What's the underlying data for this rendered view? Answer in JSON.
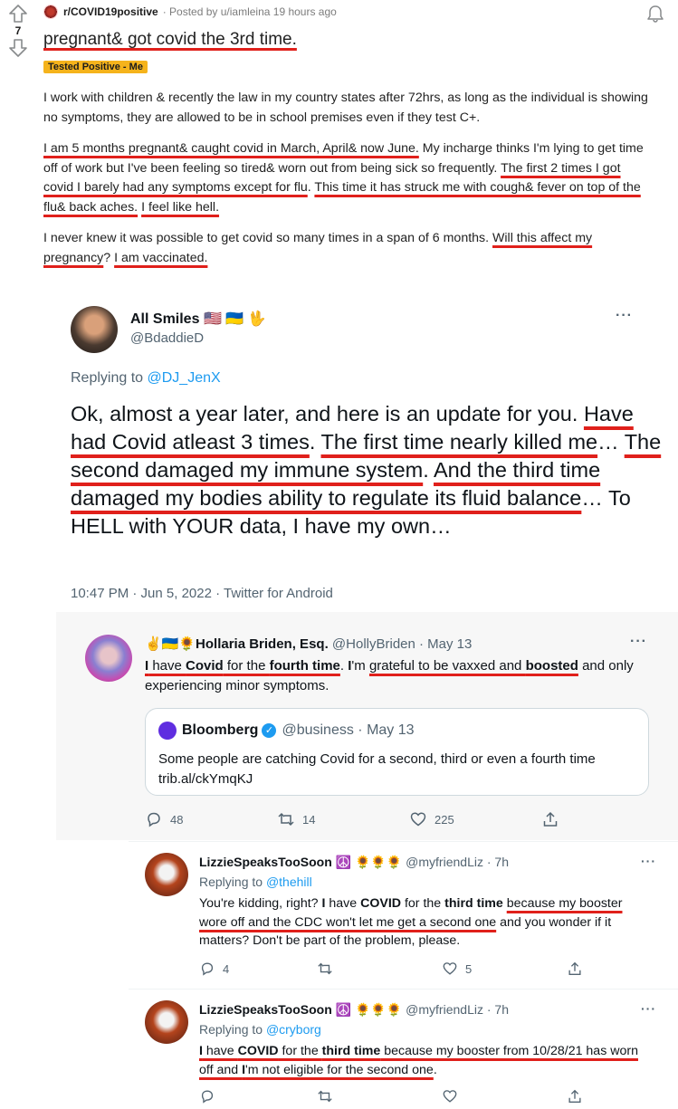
{
  "reddit": {
    "subreddit": "r/COVID19positive",
    "posted_by": "· Posted by u/iamleina 19 hours ago",
    "score": "7",
    "title": "pregnant& got covid the 3rd time.",
    "flair": "Tested Positive - Me",
    "p1": "I work with children & recently the law in my country states after 72hrs, as long as the individual is showing no symptoms, they are allowed to be in school premises even if they test C+.",
    "p2_a": "I am 5 months pregnant& caught covid in March, April& now June.",
    "p2_b": " My incharge thinks I'm lying to get time off of work but I've been feeling so tired& worn out from being sick so frequently. ",
    "p2_c": "The first 2 times I got covid I barely had any symptoms except for flu",
    "p2_d": ". ",
    "p2_e": "This time it has struck me with cough& fever on top of the flu& back aches.",
    "p2_f": " ",
    "p2_g": "I feel like hell.",
    "p3_a": "I never knew it was possible to get covid so many times in a span of 6 months. ",
    "p3_b": "Will this affect my pregnancy",
    "p3_c": "? ",
    "p3_d": "I am vaccinated."
  },
  "tweet1": {
    "name": "All Smiles",
    "name_emoji": "🇺🇸 🇺🇦 🖖",
    "handle": "@BdaddieD",
    "replying_label": "Replying to ",
    "replying_to": "@DJ_JenX",
    "t_a": "Ok, almost a year later, and here is an update for you. ",
    "t_b": "Have had Covid atleast 3 times",
    "t_c": ". ",
    "t_d": "The first time nearly killed me",
    "t_e": "… ",
    "t_f": "The second damaged my immune system",
    "t_g": ". ",
    "t_h": "And the third time damaged my bodies ability to regulate its fluid balance",
    "t_i": "… To HELL with YOUR data, I have my own…",
    "date": "10:47 PM · Jun 5, 2022 · Twitter for Android",
    "more": "···"
  },
  "tweet2": {
    "name_emoji": "✌️🇺🇦🌻",
    "name": "Hollaria Briden, Esq.",
    "handle_time": "@HollyBriden · May 13",
    "more": "···",
    "t_a": "I",
    "t_b": " have ",
    "t_c": "Covid",
    "t_d": " for the ",
    "t_e": "fourth time",
    "t_f": ".  ",
    "t_g": "I",
    "t_h": "'m ",
    "t_i": "grateful to be vaxxed and ",
    "t_j": "boosted",
    "t_k": " and only experiencing minor symptoms.",
    "quote": {
      "name": "Bloomberg",
      "handle_time": "@business · May 13",
      "text": "Some people are catching Covid for a second, third or even a fourth time trib.al/ckYmqKJ"
    },
    "replies": "48",
    "retweets": "14",
    "likes": "225"
  },
  "tweet3": {
    "name": "LizzieSpeaksTooSoon",
    "name_emoji": "☮️ 🌻🌻🌻",
    "handle_time": "@myfriendLiz · 7h",
    "more": "···",
    "replying_label": "Replying to ",
    "replying_to": "@thehill",
    "t_a": "You're kidding, right? ",
    "t_b": "I",
    "t_c": " have ",
    "t_d": "COVID",
    "t_e": " for the ",
    "t_f": "third time",
    "t_g": " ",
    "t_h": "because my booster wore off and the CDC won't let me get a second one",
    "t_i": " and you wonder if it matters? Don't be part of the problem, please.",
    "replies": "4",
    "retweets": "",
    "likes": "5"
  },
  "tweet4": {
    "name": "LizzieSpeaksTooSoon",
    "name_emoji": "☮️ 🌻🌻🌻",
    "handle_time": "@myfriendLiz · 7h",
    "more": "···",
    "replying_label": "Replying to ",
    "replying_to": "@cryborg",
    "t_a": "I",
    "t_b": " have ",
    "t_c": "COVID",
    "t_d": " for the ",
    "t_e": "third time",
    "t_f": " because my booster from 10/28/21 has worn off and ",
    "t_g": "I",
    "t_h": "'m not eligible for the second one",
    "t_i": "."
  }
}
